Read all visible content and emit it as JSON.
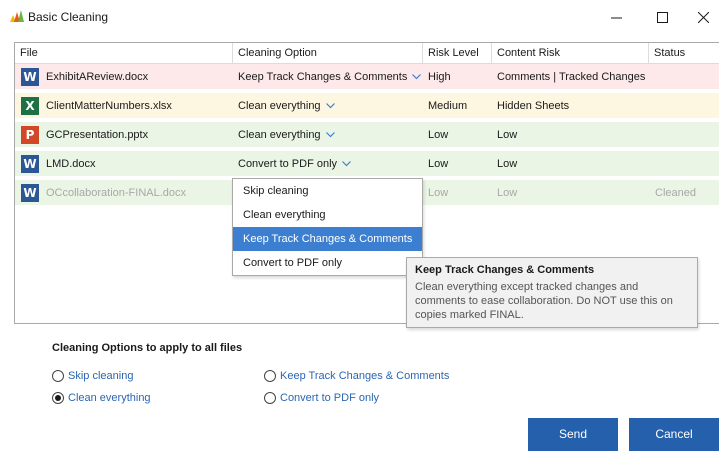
{
  "window": {
    "title": "Basic Cleaning",
    "logo_colors": [
      "#f7b500",
      "#e85a1b",
      "#6cb33f"
    ]
  },
  "grid": {
    "columns": [
      "File",
      "Cleaning Option",
      "Risk Level",
      "Content Risk",
      "Status"
    ],
    "rows": [
      {
        "icon": "W",
        "icon_name": "word-icon",
        "icon_color": "#2b5797",
        "file": "ExhibitAReview.docx",
        "option": "Keep Track Changes & Comments",
        "risk": "High",
        "content_risk": "Comments | Tracked Changes",
        "status": "",
        "bg": "#fde9e9"
      },
      {
        "icon": "X",
        "icon_name": "excel-icon",
        "icon_color": "#1e7145",
        "file": "ClientMatterNumbers.xlsx",
        "option": "Clean everything",
        "risk": "Medium",
        "content_risk": "Hidden Sheets",
        "status": "",
        "bg": "#fdf6e1"
      },
      {
        "icon": "P",
        "icon_name": "powerpoint-icon",
        "icon_color": "#d24726",
        "file": "GCPresentation.pptx",
        "option": "Clean everything",
        "risk": "Low",
        "content_risk": "Low",
        "status": "",
        "bg": "#eaf5e5"
      },
      {
        "icon": "W",
        "icon_name": "word-icon",
        "icon_color": "#2b5797",
        "file": "LMD.docx",
        "option": "Convert to PDF only",
        "risk": "Low",
        "content_risk": "Low",
        "status": "",
        "bg": "#eaf5e5"
      },
      {
        "icon": "W",
        "icon_name": "word-icon",
        "icon_color": "#2b5797",
        "file": "OCcollaboration-FINAL.docx",
        "option": "",
        "risk": "Low",
        "content_risk": "Low",
        "status": "Cleaned",
        "bg": "#eaf5e5"
      }
    ]
  },
  "dropdown": {
    "items": [
      "Skip cleaning",
      "Clean everything",
      "Keep Track Changes & Comments",
      "Convert to PDF only"
    ],
    "selected_index": 2
  },
  "tooltip": {
    "title": "Keep Track Changes & Comments",
    "body": "Clean everything except tracked changes and comments to ease collaboration. Do NOT use this on copies marked FINAL."
  },
  "options": {
    "title": "Cleaning Options to apply to all files",
    "radios": [
      {
        "label": "Skip cleaning",
        "checked": false
      },
      {
        "label": "Clean everything",
        "checked": true
      },
      {
        "label": "Keep Track Changes & Comments",
        "checked": false
      },
      {
        "label": "Convert to PDF only",
        "checked": false
      }
    ]
  },
  "buttons": {
    "send": "Send",
    "cancel": "Cancel",
    "color": "#2460ac"
  }
}
